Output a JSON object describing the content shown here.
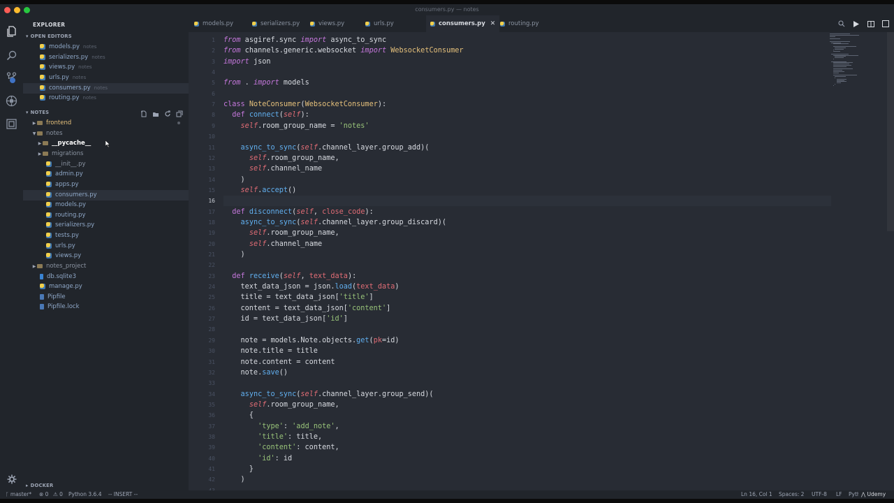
{
  "window": {
    "title": "consumers.py — notes"
  },
  "sidebar": {
    "title": "EXPLORER",
    "open_editors_label": "OPEN EDITORS",
    "open_editors": [
      {
        "name": "models.py",
        "desc": "notes"
      },
      {
        "name": "serializers.py",
        "desc": "notes"
      },
      {
        "name": "views.py",
        "desc": "notes"
      },
      {
        "name": "urls.py",
        "desc": "notes"
      },
      {
        "name": "consumers.py",
        "desc": "notes"
      },
      {
        "name": "routing.py",
        "desc": "notes"
      }
    ],
    "notes_label": "NOTES",
    "tree": [
      {
        "name": "frontend"
      },
      {
        "name": "notes"
      },
      {
        "name": "__pycache__"
      },
      {
        "name": "migrations"
      },
      {
        "name": "__init__.py"
      },
      {
        "name": "admin.py"
      },
      {
        "name": "apps.py"
      },
      {
        "name": "consumers.py"
      },
      {
        "name": "models.py"
      },
      {
        "name": "routing.py"
      },
      {
        "name": "serializers.py"
      },
      {
        "name": "tests.py"
      },
      {
        "name": "urls.py"
      },
      {
        "name": "views.py"
      },
      {
        "name": "notes_project"
      },
      {
        "name": "db.sqlite3"
      },
      {
        "name": "manage.py"
      },
      {
        "name": "Pipfile"
      },
      {
        "name": "Pipfile.lock"
      }
    ],
    "docker_label": "DOCKER"
  },
  "tabs": [
    {
      "label": "models.py"
    },
    {
      "label": "serializers.py"
    },
    {
      "label": "views.py"
    },
    {
      "label": "urls.py"
    },
    {
      "label": "consumers.py",
      "close": "✕"
    },
    {
      "label": "routing.py"
    }
  ],
  "editor": {
    "current_line": 16,
    "lines": [
      "from asgiref.sync import async_to_sync",
      "from channels.generic.websocket import WebsocketConsumer",
      "import json",
      "",
      "from . import models",
      "",
      "class NoteConsumer(WebsocketConsumer):",
      "    def connect(self):",
      "        self.room_group_name = 'notes'",
      "",
      "        async_to_sync(self.channel_layer.group_add)(",
      "            self.room_group_name,",
      "            self.channel_name",
      "        )",
      "        self.accept()",
      "",
      "    def disconnect(self, close_code):",
      "        async_to_sync(self.channel_layer.group_discard)(",
      "            self.room_group_name,",
      "            self.channel_name",
      "        )",
      "",
      "    def receive(self, text_data):",
      "        text_data_json = json.load(text_data)",
      "        title = text_data_json['title']",
      "        content = text_data_json['content']",
      "        id = text_data_json['id']",
      "",
      "        note = models.Note.objects.get(pk=id)",
      "        note.title = title",
      "        note.content = content",
      "        note.save()",
      "",
      "        async_to_sync(self.channel_layer.group_send)(",
      "            self.room_group_name,",
      "            {",
      "                'type': 'add_note',",
      "                'title': title,",
      "                'content': content,",
      "                'id': id",
      "            }",
      "        )",
      ""
    ]
  },
  "status": {
    "branch": "master*",
    "errors": "⊗ 0",
    "warnings": "⚠ 0",
    "python": "Python 3.6.4",
    "mode": "-- INSERT --",
    "position": "Ln 16, Col 1",
    "spaces": "Spaces: 2",
    "encoding": "UTF-8",
    "eol": "LF",
    "language": "Python",
    "watermark": "Udemy"
  },
  "colors": {
    "keyword": "#c678dd",
    "function": "#61afef",
    "class": "#e5c07b",
    "string": "#98c379",
    "self": "#e06c75",
    "background": "#282c34",
    "sidebar": "#21252b"
  }
}
